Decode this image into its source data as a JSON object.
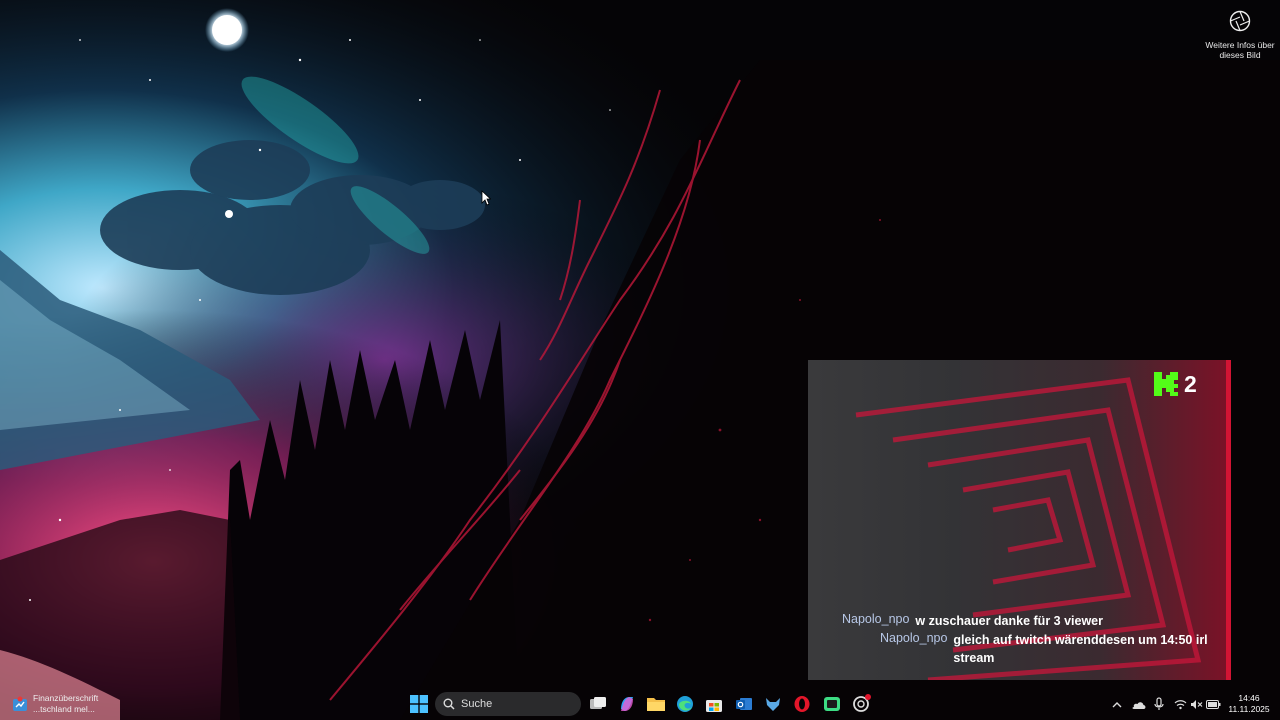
{
  "desktop": {
    "spotlight": {
      "label_line1": "Weitere Infos über",
      "label_line2": "dieses Bild",
      "icon": "camera-aperture-icon"
    }
  },
  "overlay": {
    "logo_text": "2",
    "logo_color": "#53fc18",
    "accent_color": "#d21434",
    "chat": [
      {
        "user": "Napolo_npo",
        "message": "w zuschauer danke für 3 viewer"
      },
      {
        "user": "Napolo_npo",
        "message": "gleich auf twitch wärenddesen um 14:50 irl stream"
      }
    ]
  },
  "taskbar": {
    "widget": {
      "line1": "Finanzüberschrift",
      "line2": "...tschland mel..."
    },
    "search_placeholder": "Suche",
    "apps": [
      "windows-start-icon",
      "search-icon",
      "task-view-icon",
      "copilot-icon",
      "file-explorer-icon",
      "edge-browser-icon",
      "microsoft-store-icon",
      "outlook-icon",
      "wolf-app-icon",
      "opera-icon",
      "android-app-icon",
      "chatgpt-icon"
    ],
    "tray": [
      "chevron-up-icon",
      "onedrive-icon",
      "microphone-icon",
      "wifi-icon",
      "volume-muted-icon",
      "battery-icon"
    ],
    "time": "14:46",
    "date": "11.11.2025"
  }
}
